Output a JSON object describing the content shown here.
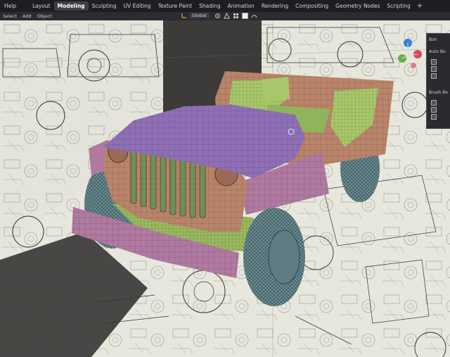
{
  "topbar": {
    "menus": [
      "Help"
    ],
    "tabs": [
      "Layout",
      "Modeling",
      "Sculpting",
      "UV Editing",
      "Texture Paint",
      "Shading",
      "Animation",
      "Rendering",
      "Compositing",
      "Geometry Nodes",
      "Scripting"
    ],
    "active_tab": "Modeling",
    "add_label": "+"
  },
  "header": {
    "menus": [
      "Select",
      "Add",
      "Object"
    ],
    "orientation": "Global"
  },
  "npanel": {
    "title": "Bon",
    "section1": "Auto Bo",
    "section2": "Brush Bo"
  },
  "colors": {
    "body_orange": "#b9846a",
    "hood_purple": "#8e6fb6",
    "bumper_pink": "#b07aa0",
    "tire_teal": "#6e8f96",
    "seat_green": "#a6c56a",
    "blueprint_paper": "#e6e5d9"
  }
}
